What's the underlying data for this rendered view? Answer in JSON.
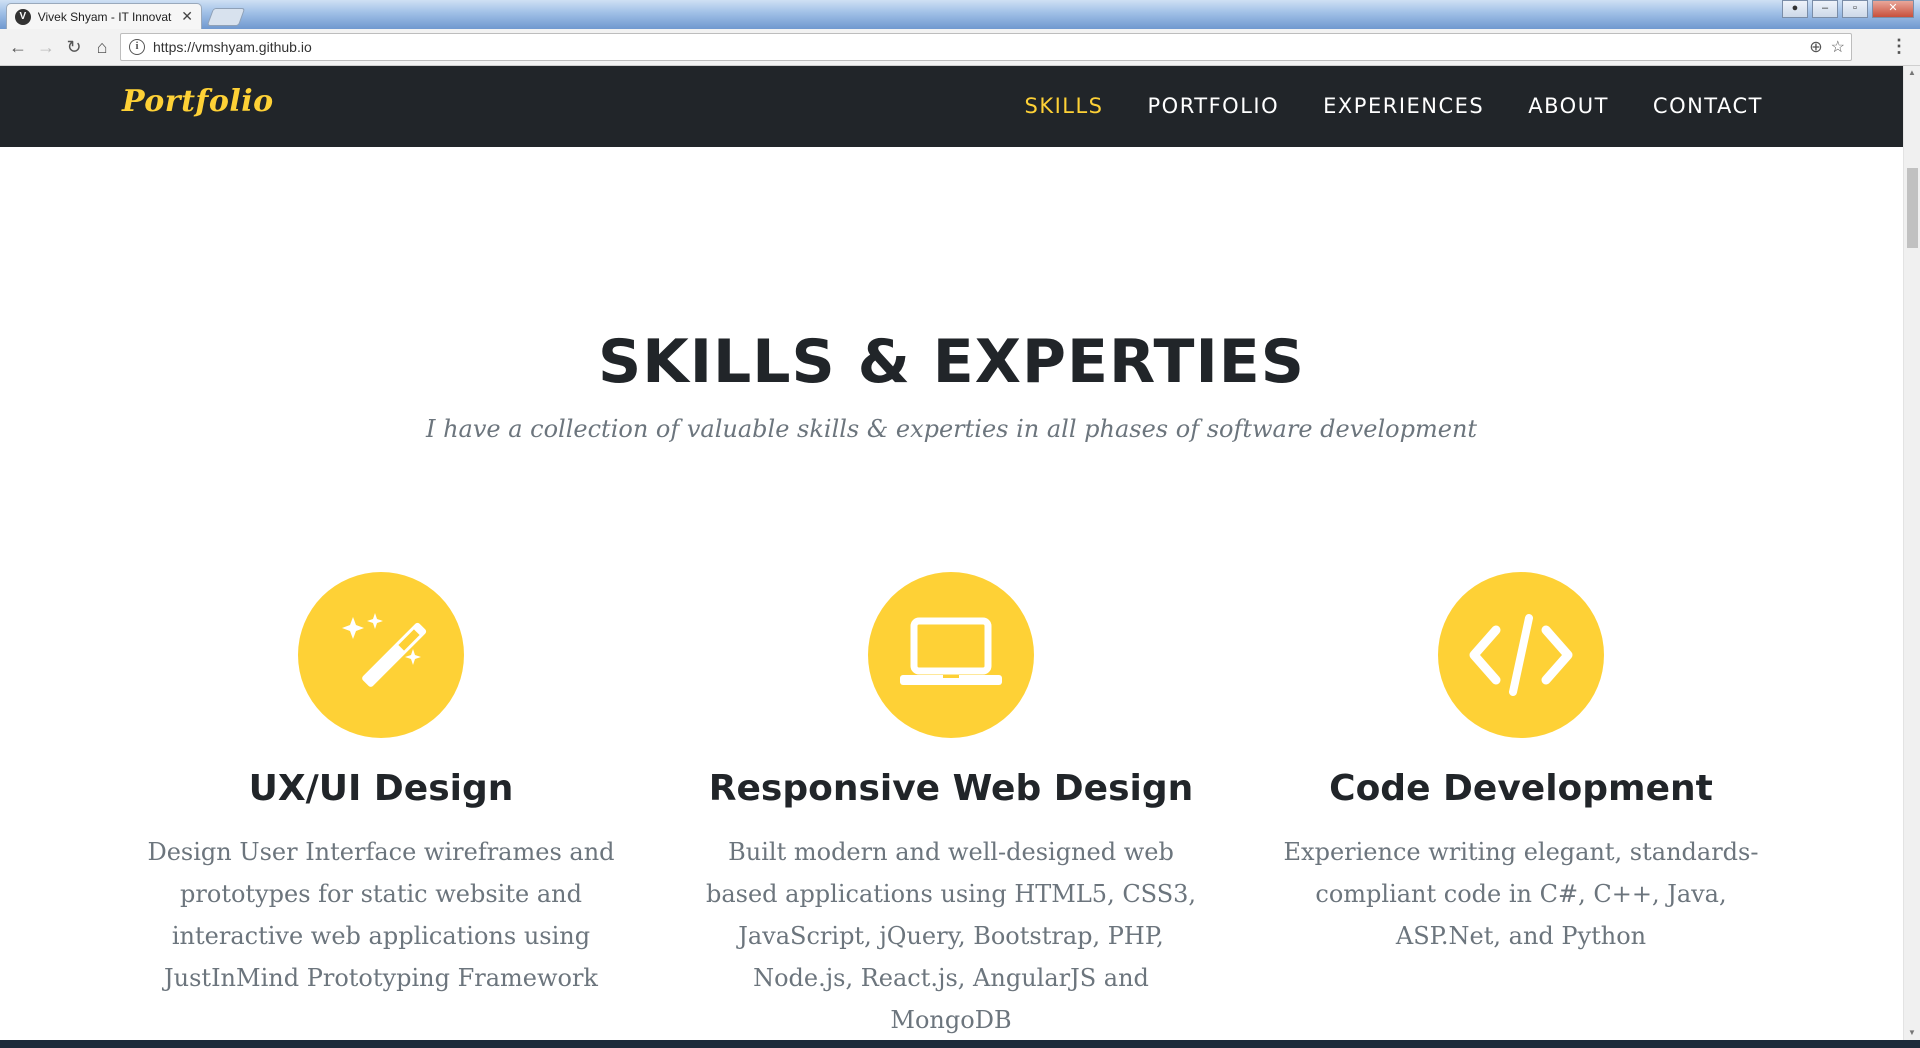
{
  "browser": {
    "tab_title": "Vivek Shyam - IT Innovat",
    "tab_favicon_letter": "V",
    "url": "https://vmshyam.github.io"
  },
  "site": {
    "brand": "Portfolio",
    "nav": [
      {
        "label": "SKILLS",
        "active": true
      },
      {
        "label": "PORTFOLIO",
        "active": false
      },
      {
        "label": "EXPERIENCES",
        "active": false
      },
      {
        "label": "ABOUT",
        "active": false
      },
      {
        "label": "CONTACT",
        "active": false
      }
    ],
    "accent_color": "#fed136",
    "nav_bg_color": "#212529"
  },
  "section": {
    "heading": "SKILLS & EXPERTIES",
    "subheading": "I have a collection of valuable skills & experties in all phases of software development",
    "skills": [
      {
        "icon": "magic-wand-icon",
        "title": "UX/UI Design",
        "text": "Design User Interface wireframes and prototypes for static website and interactive web applications using JustInMind Prototyping Framework"
      },
      {
        "icon": "laptop-icon",
        "title": "Responsive Web Design",
        "text": "Built modern and well-designed web based applications using HTML5, CSS3, JavaScript, jQuery, Bootstrap, PHP, Node.js, React.js, AngularJS and MongoDB"
      },
      {
        "icon": "code-icon",
        "title": "Code Development",
        "text": "Experience writing elegant, standards-compliant code in C#, C++, Java, ASP.Net, and Python"
      }
    ]
  }
}
